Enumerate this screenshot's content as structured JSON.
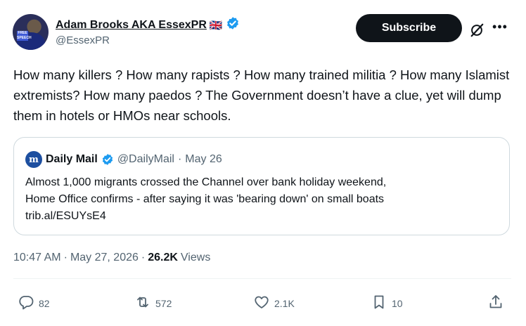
{
  "author": {
    "display_name": "Adam Brooks AKA EssexPR",
    "flag": "🇬🇧",
    "handle": "@EssexPR",
    "avatar_badge_text": "FREE SPEECH"
  },
  "header": {
    "subscribe_label": "Subscribe"
  },
  "tweet": {
    "text": "How many killers ? How many rapists ? How many trained militia ? How many Islamist extremists? How many paedos ? The Government doesn’t have a clue, yet will dump them in hotels or HMOs near schools."
  },
  "quote": {
    "logo_letter": "m",
    "name": "Daily Mail",
    "handle": "@DailyMail",
    "separator": "·",
    "date": "May 26",
    "text_line1": "Almost 1,000 migrants crossed the Channel over bank holiday weekend,",
    "text_line2": "Home Office confirms - after saying it was 'bearing down' on small boats",
    "link": "trib.al/ESUYsE4"
  },
  "meta": {
    "time": "10:47 AM",
    "dot": "·",
    "date": "May 27, 2026",
    "views_count": "26.2K",
    "views_label": "Views"
  },
  "actions": {
    "replies": "82",
    "reposts": "572",
    "likes": "2.1K",
    "bookmarks": "10"
  },
  "colors": {
    "verified": "#1d9bf0",
    "secondary_text": "#536471",
    "subscribe_bg": "#0f1419"
  },
  "icons": [
    "verified-badge-icon",
    "grok-icon",
    "more-icon",
    "reply-icon",
    "repost-icon",
    "like-icon",
    "bookmark-icon",
    "share-icon"
  ]
}
